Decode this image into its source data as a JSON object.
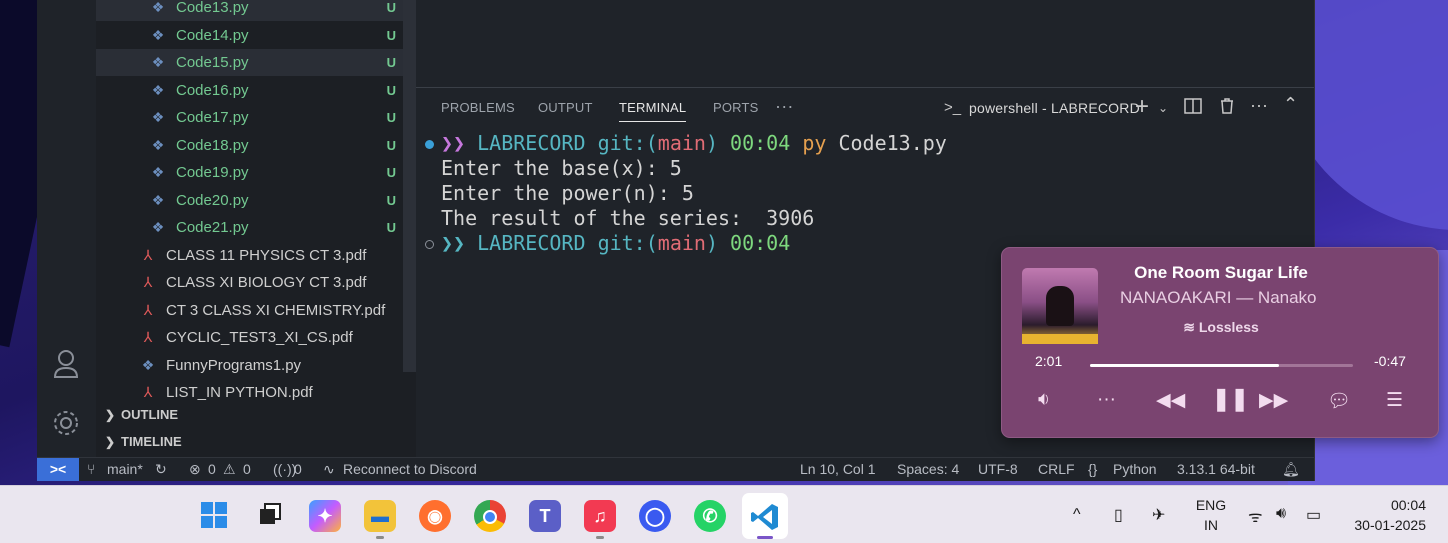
{
  "explorer": {
    "files": [
      {
        "name": "Code13.py",
        "kind": "py",
        "git": "U",
        "selected": true
      },
      {
        "name": "Code14.py",
        "kind": "py",
        "git": "U",
        "selected": false
      },
      {
        "name": "Code15.py",
        "kind": "py",
        "git": "U",
        "selected": true
      },
      {
        "name": "Code16.py",
        "kind": "py",
        "git": "U",
        "selected": false
      },
      {
        "name": "Code17.py",
        "kind": "py",
        "git": "U",
        "selected": false
      },
      {
        "name": "Code18.py",
        "kind": "py",
        "git": "U",
        "selected": false
      },
      {
        "name": "Code19.py",
        "kind": "py",
        "git": "U",
        "selected": false
      },
      {
        "name": "Code20.py",
        "kind": "py",
        "git": "U",
        "selected": false
      },
      {
        "name": "Code21.py",
        "kind": "py",
        "git": "U",
        "selected": false
      },
      {
        "name": "CLASS 11 PHYSICS CT 3.pdf",
        "kind": "pdf",
        "git": "",
        "selected": false
      },
      {
        "name": "CLASS XI BIOLOGY  CT 3.pdf",
        "kind": "pdf",
        "git": "",
        "selected": false
      },
      {
        "name": "CT 3 CLASS  XI CHEMISTRY.pdf",
        "kind": "pdf",
        "git": "",
        "selected": false
      },
      {
        "name": "CYCLIC_TEST3_XI_CS.pdf",
        "kind": "pdf",
        "git": "",
        "selected": false
      },
      {
        "name": "FunnyPrograms1.py",
        "kind": "py",
        "git": "",
        "selected": false
      },
      {
        "name": "LIST_IN PYTHON.pdf",
        "kind": "pdf",
        "git": "",
        "selected": false
      }
    ],
    "outline_label": "OUTLINE",
    "timeline_label": "TIMELINE"
  },
  "panel": {
    "tabs": [
      "PROBLEMS",
      "OUTPUT",
      "TERMINAL",
      "PORTS"
    ],
    "active_tab": "TERMINAL",
    "more": "···",
    "shell_name": "powershell - LABRECORD"
  },
  "terminal": {
    "prompt_arrow": "❯❯",
    "dir": "LABRECORD",
    "git_prefix": "git:(",
    "branch": "main",
    "git_suffix": ")",
    "time": "00:04",
    "cmd_py": "py",
    "cmd_arg": "Code13.py",
    "output": [
      "Enter the base(x): 5",
      "Enter the power(n): 5",
      "The result of the series:  3906"
    ]
  },
  "status": {
    "branch": "main*",
    "errors": "0",
    "warnings": "0",
    "ports": "0",
    "discord": "Reconnect to Discord",
    "position": "Ln 10, Col 1",
    "spaces": "Spaces: 4",
    "encoding": "UTF-8",
    "eol": "CRLF",
    "language": "Python",
    "interpreter": "3.13.1 64-bit"
  },
  "player": {
    "title": "One Room Sugar Life",
    "artist": "NANAOAKARI — Nanako",
    "quality": "Lossless",
    "elapsed": "2:01",
    "remaining": "-0:47",
    "progress_fraction": 0.72
  },
  "tray": {
    "lang_line1": "ENG",
    "lang_line2": "IN",
    "time": "00:04",
    "date": "30-01-2025"
  },
  "colors": {
    "git_untracked": "#73c991",
    "statusbar_remote": "#3a6fd8",
    "player_bg": "#7a4470"
  }
}
